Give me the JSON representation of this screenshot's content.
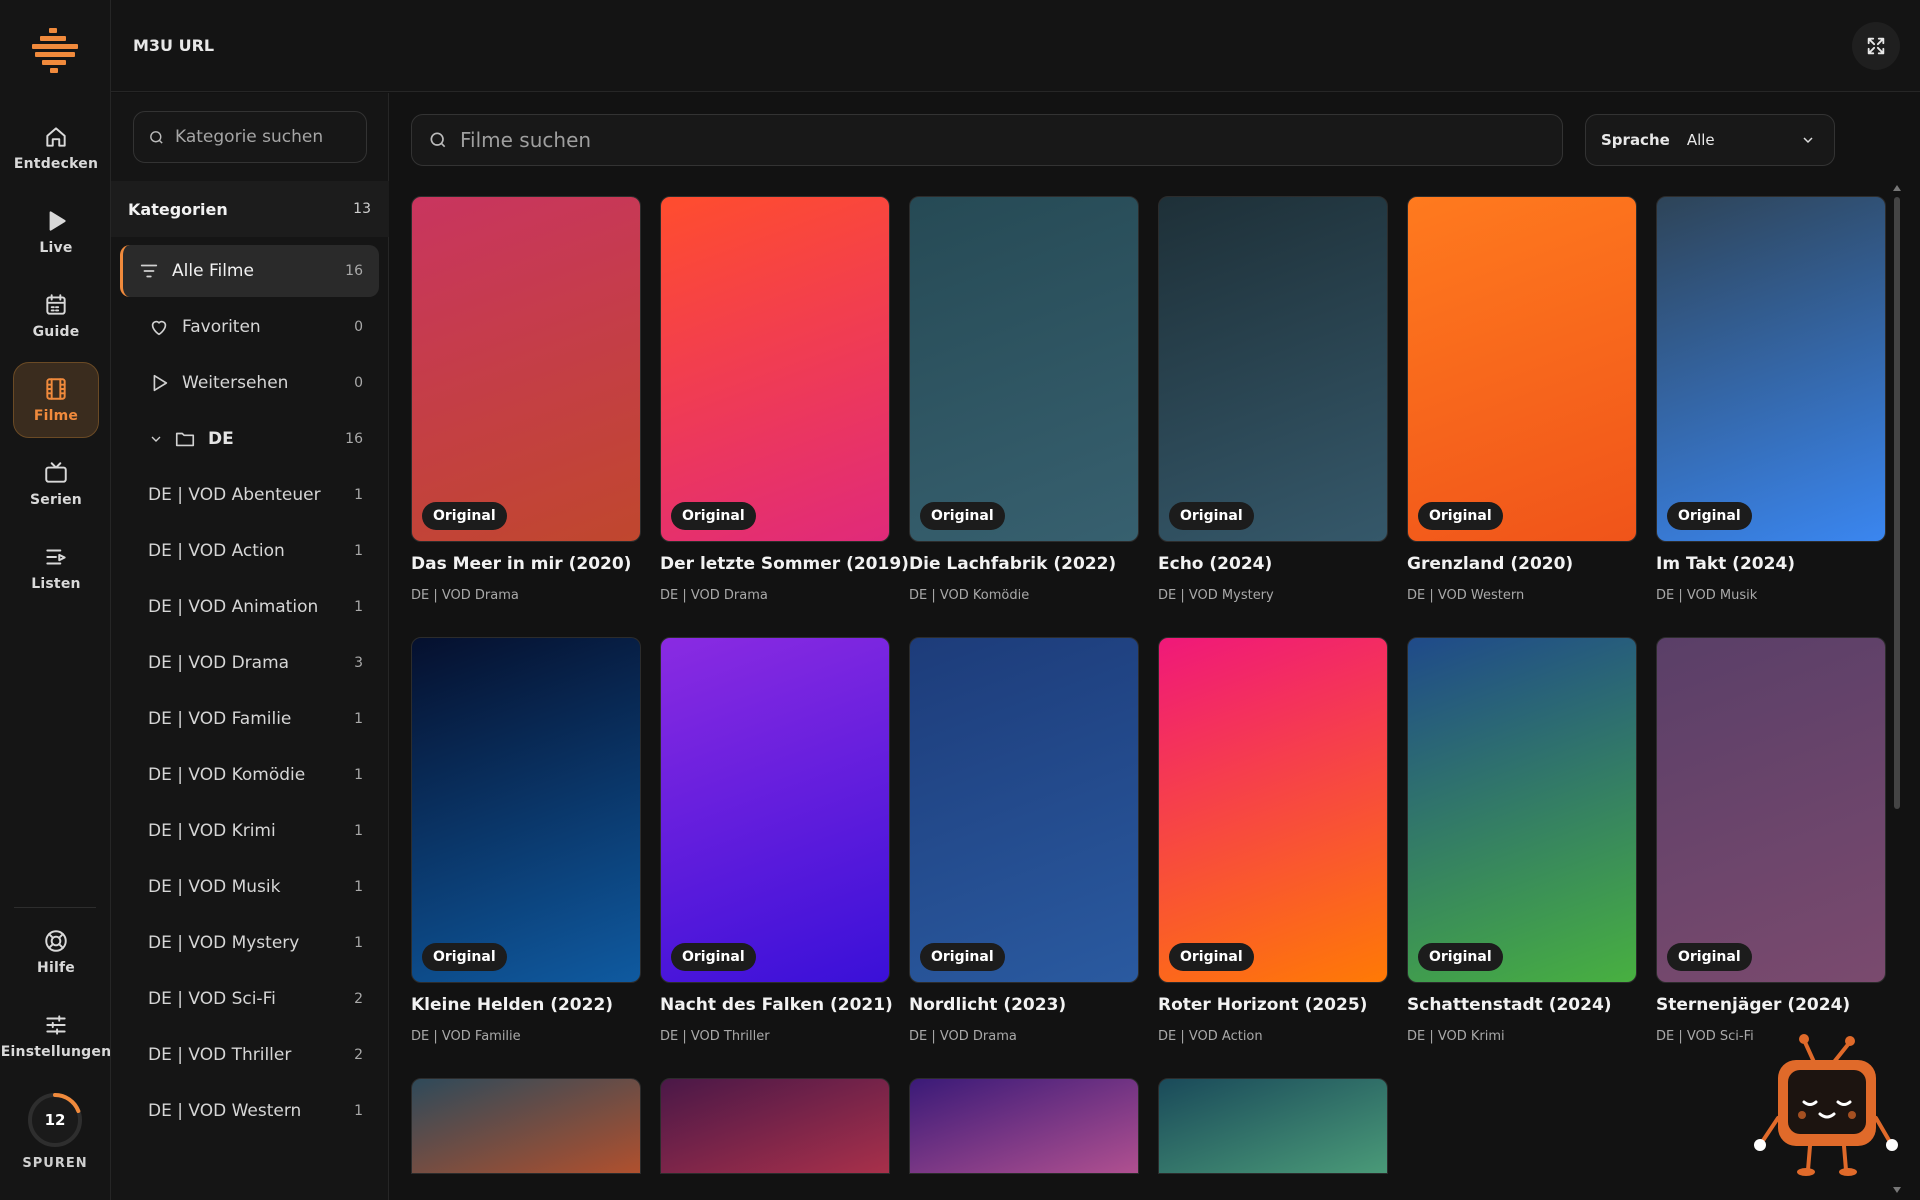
{
  "app": {
    "title": "M3U URL"
  },
  "rail": {
    "items": [
      {
        "label": "Entdecken",
        "icon": "home-icon"
      },
      {
        "label": "Live",
        "icon": "play-icon"
      },
      {
        "label": "Guide",
        "icon": "calendar-icon"
      },
      {
        "label": "Filme",
        "icon": "film-icon",
        "active": true
      },
      {
        "label": "Serien",
        "icon": "tv-icon"
      },
      {
        "label": "Listen",
        "icon": "list-icon"
      }
    ],
    "bottom": [
      {
        "label": "Hilfe",
        "icon": "lifebuoy-icon"
      },
      {
        "label": "Einstellungen",
        "icon": "sliders-icon"
      }
    ],
    "spuren": {
      "value": "12",
      "label": "SPUREN"
    }
  },
  "categories": {
    "search_placeholder": "Kategorie suchen",
    "header": "Kategorien",
    "count": "13",
    "items": [
      {
        "name": "Alle Filme",
        "count": "16",
        "icon": "filter-icon",
        "active": true
      },
      {
        "name": "Favoriten",
        "count": "0",
        "icon": "heart-icon"
      },
      {
        "name": "Weitersehen",
        "count": "0",
        "icon": "play-outline-icon"
      },
      {
        "name": "DE",
        "count": "16",
        "icon": "folder-icon"
      },
      {
        "name": "DE | VOD Abenteuer",
        "count": "1"
      },
      {
        "name": "DE | VOD Action",
        "count": "1"
      },
      {
        "name": "DE | VOD Animation",
        "count": "1"
      },
      {
        "name": "DE | VOD Drama",
        "count": "3"
      },
      {
        "name": "DE | VOD Familie",
        "count": "1"
      },
      {
        "name": "DE | VOD Komödie",
        "count": "1"
      },
      {
        "name": "DE | VOD Krimi",
        "count": "1"
      },
      {
        "name": "DE | VOD Musik",
        "count": "1"
      },
      {
        "name": "DE | VOD Mystery",
        "count": "1"
      },
      {
        "name": "DE | VOD Sci-Fi",
        "count": "2"
      },
      {
        "name": "DE | VOD Thriller",
        "count": "2"
      },
      {
        "name": "DE | VOD Western",
        "count": "1"
      }
    ]
  },
  "main": {
    "search_placeholder": "Filme suchen",
    "language": {
      "label": "Sprache",
      "value": "Alle"
    },
    "badge_label": "Original",
    "movies": [
      {
        "title": "Das Meer in mir (2020)",
        "category": "DE | VOD Drama",
        "c1": "#c9355f",
        "c2": "#c0472e"
      },
      {
        "title": "Der letzte Sommer (2019)",
        "category": "DE | VOD Drama",
        "c1": "#ff4d2e",
        "c2": "#e02a7a"
      },
      {
        "title": "Die Lachfabrik (2022)",
        "category": "DE | VOD Komödie",
        "c1": "#264a55",
        "c2": "#37606f"
      },
      {
        "title": "Echo (2024)",
        "category": "DE | VOD Mystery",
        "c1": "#1e3038",
        "c2": "#35586a"
      },
      {
        "title": "Grenzland (2020)",
        "category": "DE | VOD Western",
        "c1": "#ff7a1e",
        "c2": "#f0541a"
      },
      {
        "title": "Im Takt (2024)",
        "category": "DE | VOD Musik",
        "c1": "#2e4458",
        "c2": "#3a86f0"
      },
      {
        "title": "Kleine Helden (2022)",
        "category": "DE | VOD Familie",
        "c1": "#05102e",
        "c2": "#0f5aa0"
      },
      {
        "title": "Nacht des Falken (2021)",
        "category": "DE | VOD Thriller",
        "c1": "#8a2be2",
        "c2": "#3a10d8"
      },
      {
        "title": "Nordlicht (2023)",
        "category": "DE | VOD Drama",
        "c1": "#1d3c7a",
        "c2": "#2a5aa0"
      },
      {
        "title": "Roter Horizont (2025)",
        "category": "DE | VOD Action",
        "c1": "#f0187a",
        "c2": "#ff7a05"
      },
      {
        "title": "Schattenstadt (2024)",
        "category": "DE | VOD Krimi",
        "c1": "#1f4a8a",
        "c2": "#48b040"
      },
      {
        "title": "Sternenjäger (2024)",
        "category": "DE | VOD Sci-Fi",
        "c1": "#5a3f68",
        "c2": "#7a4a6e"
      },
      {
        "title": "",
        "category": "",
        "c1": "#2e4a5a",
        "c2": "#b0502e"
      },
      {
        "title": "",
        "category": "",
        "c1": "#4a1848",
        "c2": "#a8304a"
      },
      {
        "title": "",
        "category": "",
        "c1": "#3a1a78",
        "c2": "#b05090"
      },
      {
        "title": "",
        "category": "",
        "c1": "#1a4a5a",
        "c2": "#4a9a78"
      }
    ]
  },
  "colors": {
    "accent": "#f08a3c",
    "background": "#121212",
    "panel": "#151515"
  }
}
